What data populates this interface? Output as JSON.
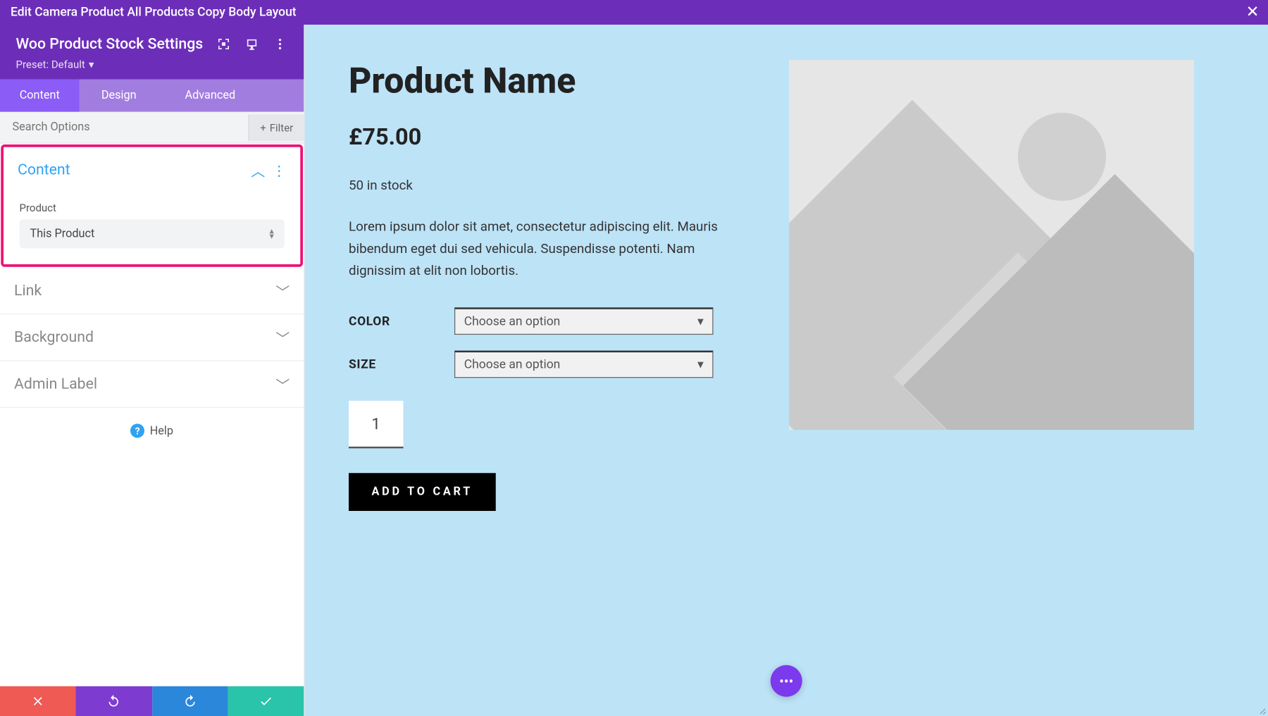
{
  "titlebar": {
    "text": "Edit Camera Product All Products Copy Body Layout"
  },
  "module": {
    "title": "Woo Product Stock Settings",
    "preset_label": "Preset: Default"
  },
  "tabs": {
    "content": "Content",
    "design": "Design",
    "advanced": "Advanced"
  },
  "search": {
    "placeholder": "Search Options",
    "filter_label": "Filter"
  },
  "sections": {
    "content": {
      "title": "Content",
      "product_label": "Product",
      "product_value": "This Product"
    },
    "link": "Link",
    "background": "Background",
    "admin_label": "Admin Label"
  },
  "help": "Help",
  "preview": {
    "title": "Product Name",
    "price": "£75.00",
    "stock": "50 in stock",
    "description": "Lorem ipsum dolor sit amet, consectetur adipiscing elit. Mauris bibendum eget dui sed vehicula. Suspendisse potenti. Nam dignissim at elit non lobortis.",
    "color_label": "COLOR",
    "size_label": "SIZE",
    "choose_option": "Choose an option",
    "qty": "1",
    "add_to_cart": "ADD TO CART"
  }
}
